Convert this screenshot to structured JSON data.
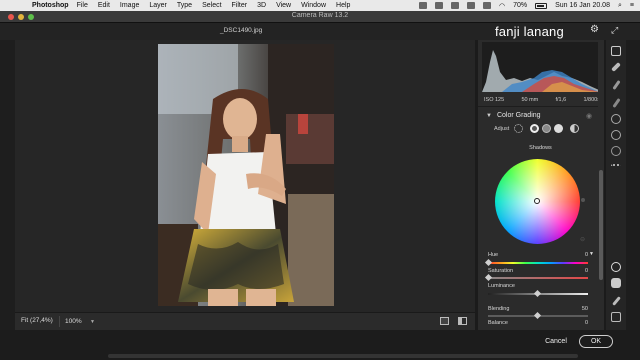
{
  "menubar": {
    "app_name": "Photoshop",
    "items": [
      "File",
      "Edit",
      "Image",
      "Layer",
      "Type",
      "Select",
      "Filter",
      "3D",
      "View",
      "Window",
      "Help"
    ],
    "battery": "70%",
    "clock": "Sun 16 Jan  20.08"
  },
  "window": {
    "title": "Camera Raw 13.2",
    "filename": "_DSC1490.jpg",
    "user_name": "fanji lanang"
  },
  "histogram": {
    "iso": "ISO 125",
    "focal": "50 mm",
    "aperture": "f/1,6",
    "shutter": "1/800s"
  },
  "color_grading": {
    "title": "Color Grading",
    "adjust_label": "Adjust",
    "wheel_title": "Shadows",
    "sliders": [
      {
        "label": "Hue",
        "value": "0"
      },
      {
        "label": "Saturation",
        "value": "0"
      },
      {
        "label": "Luminance",
        "value": "0"
      },
      {
        "label": "Blending",
        "value": "50"
      },
      {
        "label": "Balance",
        "value": "0"
      }
    ]
  },
  "bottombar": {
    "fit_label": "Fit (27,4%)",
    "zoom_value": "100%"
  },
  "actions": {
    "cancel_label": "Cancel",
    "ok_label": "OK"
  },
  "colors": {
    "panel_bg": "#2b2b2b",
    "canvas_bg": "#262626",
    "accent_close": "#e9574d"
  }
}
